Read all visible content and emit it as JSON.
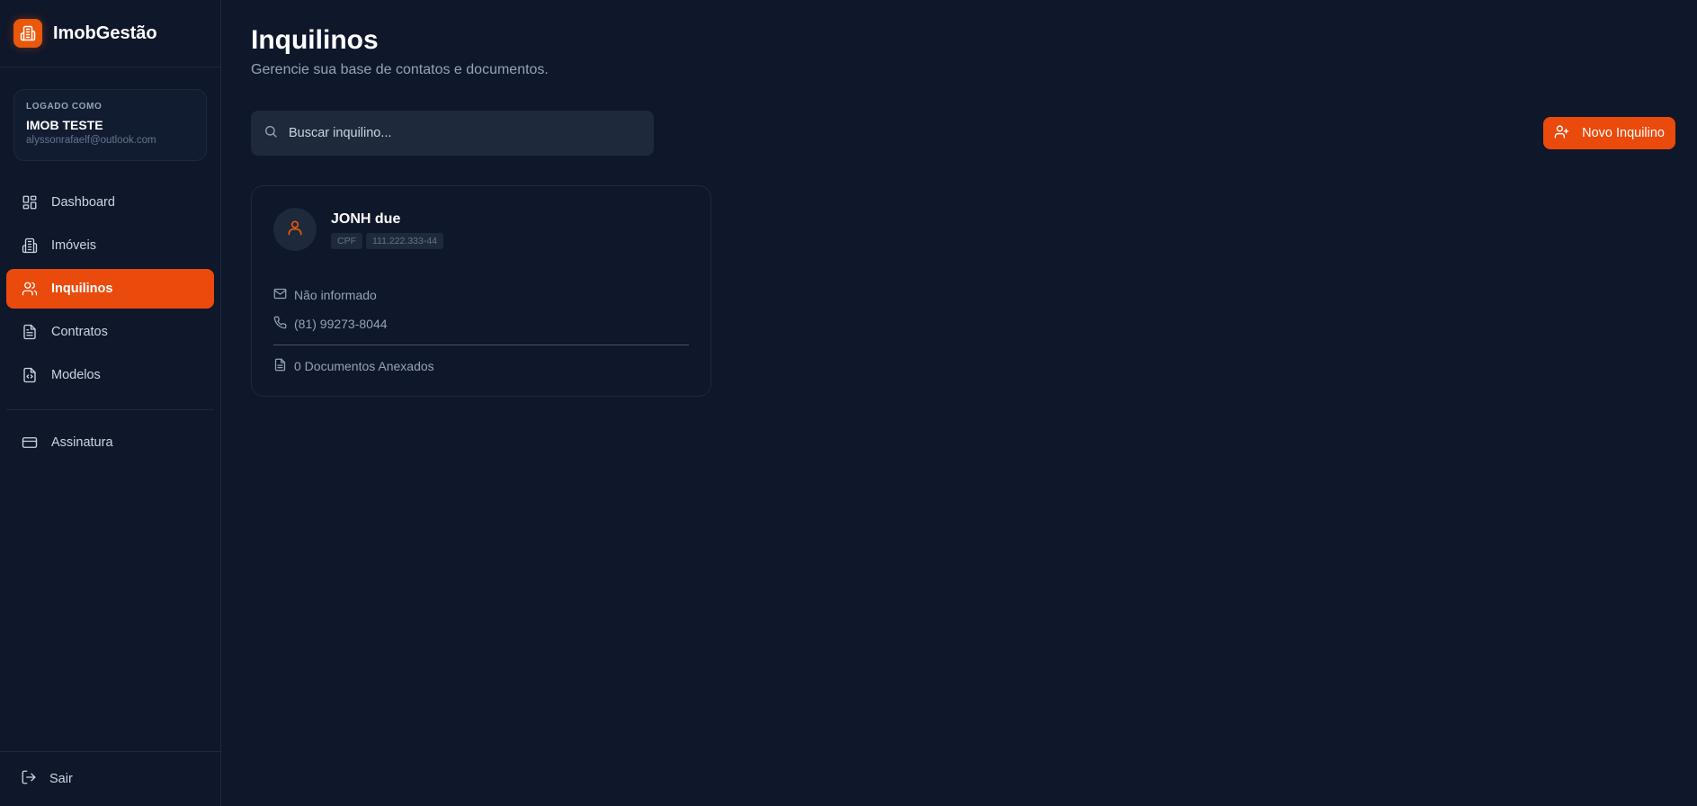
{
  "brand": {
    "name": "ImobGestão",
    "accent": "#ea580c"
  },
  "user": {
    "caption": "LOGADO COMO",
    "name": "IMOB TESTE",
    "email": "alyssonrafaelf@outlook.com"
  },
  "nav": {
    "items": [
      {
        "label": "Dashboard",
        "icon": "dashboard-icon",
        "active": false
      },
      {
        "label": "Imóveis",
        "icon": "building-icon",
        "active": false
      },
      {
        "label": "Inquilinos",
        "icon": "users-icon",
        "active": true
      },
      {
        "label": "Contratos",
        "icon": "document-icon",
        "active": false
      },
      {
        "label": "Modelos",
        "icon": "code-file-icon",
        "active": false
      }
    ],
    "secondary": [
      {
        "label": "Assinatura",
        "icon": "credit-card-icon"
      }
    ],
    "logout_label": "Sair"
  },
  "page": {
    "title": "Inquilinos",
    "subtitle": "Gerencie sua base de contatos e documentos."
  },
  "search": {
    "placeholder": "Buscar inquilino...",
    "value": ""
  },
  "actions": {
    "new_tenant_label": "Novo Inquilino"
  },
  "tenants": [
    {
      "name": "JONH due",
      "doc_type": "CPF",
      "doc_number": "111.222.333-44",
      "email": "Não informado",
      "phone": "(81) 99273-8044",
      "documents": "0 Documentos Anexados"
    }
  ]
}
